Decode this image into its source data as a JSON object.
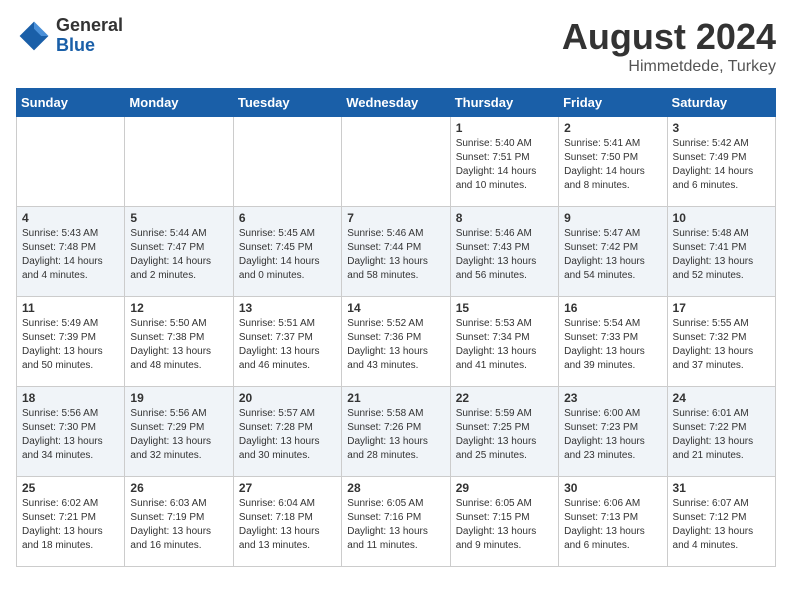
{
  "header": {
    "logo_general": "General",
    "logo_blue": "Blue",
    "title": "August 2024",
    "location": "Himmetdede, Turkey"
  },
  "days_of_week": [
    "Sunday",
    "Monday",
    "Tuesday",
    "Wednesday",
    "Thursday",
    "Friday",
    "Saturday"
  ],
  "weeks": [
    [
      {
        "day": "",
        "info": ""
      },
      {
        "day": "",
        "info": ""
      },
      {
        "day": "",
        "info": ""
      },
      {
        "day": "",
        "info": ""
      },
      {
        "day": "1",
        "info": "Sunrise: 5:40 AM\nSunset: 7:51 PM\nDaylight: 14 hours\nand 10 minutes."
      },
      {
        "day": "2",
        "info": "Sunrise: 5:41 AM\nSunset: 7:50 PM\nDaylight: 14 hours\nand 8 minutes."
      },
      {
        "day": "3",
        "info": "Sunrise: 5:42 AM\nSunset: 7:49 PM\nDaylight: 14 hours\nand 6 minutes."
      }
    ],
    [
      {
        "day": "4",
        "info": "Sunrise: 5:43 AM\nSunset: 7:48 PM\nDaylight: 14 hours\nand 4 minutes."
      },
      {
        "day": "5",
        "info": "Sunrise: 5:44 AM\nSunset: 7:47 PM\nDaylight: 14 hours\nand 2 minutes."
      },
      {
        "day": "6",
        "info": "Sunrise: 5:45 AM\nSunset: 7:45 PM\nDaylight: 14 hours\nand 0 minutes."
      },
      {
        "day": "7",
        "info": "Sunrise: 5:46 AM\nSunset: 7:44 PM\nDaylight: 13 hours\nand 58 minutes."
      },
      {
        "day": "8",
        "info": "Sunrise: 5:46 AM\nSunset: 7:43 PM\nDaylight: 13 hours\nand 56 minutes."
      },
      {
        "day": "9",
        "info": "Sunrise: 5:47 AM\nSunset: 7:42 PM\nDaylight: 13 hours\nand 54 minutes."
      },
      {
        "day": "10",
        "info": "Sunrise: 5:48 AM\nSunset: 7:41 PM\nDaylight: 13 hours\nand 52 minutes."
      }
    ],
    [
      {
        "day": "11",
        "info": "Sunrise: 5:49 AM\nSunset: 7:39 PM\nDaylight: 13 hours\nand 50 minutes."
      },
      {
        "day": "12",
        "info": "Sunrise: 5:50 AM\nSunset: 7:38 PM\nDaylight: 13 hours\nand 48 minutes."
      },
      {
        "day": "13",
        "info": "Sunrise: 5:51 AM\nSunset: 7:37 PM\nDaylight: 13 hours\nand 46 minutes."
      },
      {
        "day": "14",
        "info": "Sunrise: 5:52 AM\nSunset: 7:36 PM\nDaylight: 13 hours\nand 43 minutes."
      },
      {
        "day": "15",
        "info": "Sunrise: 5:53 AM\nSunset: 7:34 PM\nDaylight: 13 hours\nand 41 minutes."
      },
      {
        "day": "16",
        "info": "Sunrise: 5:54 AM\nSunset: 7:33 PM\nDaylight: 13 hours\nand 39 minutes."
      },
      {
        "day": "17",
        "info": "Sunrise: 5:55 AM\nSunset: 7:32 PM\nDaylight: 13 hours\nand 37 minutes."
      }
    ],
    [
      {
        "day": "18",
        "info": "Sunrise: 5:56 AM\nSunset: 7:30 PM\nDaylight: 13 hours\nand 34 minutes."
      },
      {
        "day": "19",
        "info": "Sunrise: 5:56 AM\nSunset: 7:29 PM\nDaylight: 13 hours\nand 32 minutes."
      },
      {
        "day": "20",
        "info": "Sunrise: 5:57 AM\nSunset: 7:28 PM\nDaylight: 13 hours\nand 30 minutes."
      },
      {
        "day": "21",
        "info": "Sunrise: 5:58 AM\nSunset: 7:26 PM\nDaylight: 13 hours\nand 28 minutes."
      },
      {
        "day": "22",
        "info": "Sunrise: 5:59 AM\nSunset: 7:25 PM\nDaylight: 13 hours\nand 25 minutes."
      },
      {
        "day": "23",
        "info": "Sunrise: 6:00 AM\nSunset: 7:23 PM\nDaylight: 13 hours\nand 23 minutes."
      },
      {
        "day": "24",
        "info": "Sunrise: 6:01 AM\nSunset: 7:22 PM\nDaylight: 13 hours\nand 21 minutes."
      }
    ],
    [
      {
        "day": "25",
        "info": "Sunrise: 6:02 AM\nSunset: 7:21 PM\nDaylight: 13 hours\nand 18 minutes."
      },
      {
        "day": "26",
        "info": "Sunrise: 6:03 AM\nSunset: 7:19 PM\nDaylight: 13 hours\nand 16 minutes."
      },
      {
        "day": "27",
        "info": "Sunrise: 6:04 AM\nSunset: 7:18 PM\nDaylight: 13 hours\nand 13 minutes."
      },
      {
        "day": "28",
        "info": "Sunrise: 6:05 AM\nSunset: 7:16 PM\nDaylight: 13 hours\nand 11 minutes."
      },
      {
        "day": "29",
        "info": "Sunrise: 6:05 AM\nSunset: 7:15 PM\nDaylight: 13 hours\nand 9 minutes."
      },
      {
        "day": "30",
        "info": "Sunrise: 6:06 AM\nSunset: 7:13 PM\nDaylight: 13 hours\nand 6 minutes."
      },
      {
        "day": "31",
        "info": "Sunrise: 6:07 AM\nSunset: 7:12 PM\nDaylight: 13 hours\nand 4 minutes."
      }
    ]
  ]
}
